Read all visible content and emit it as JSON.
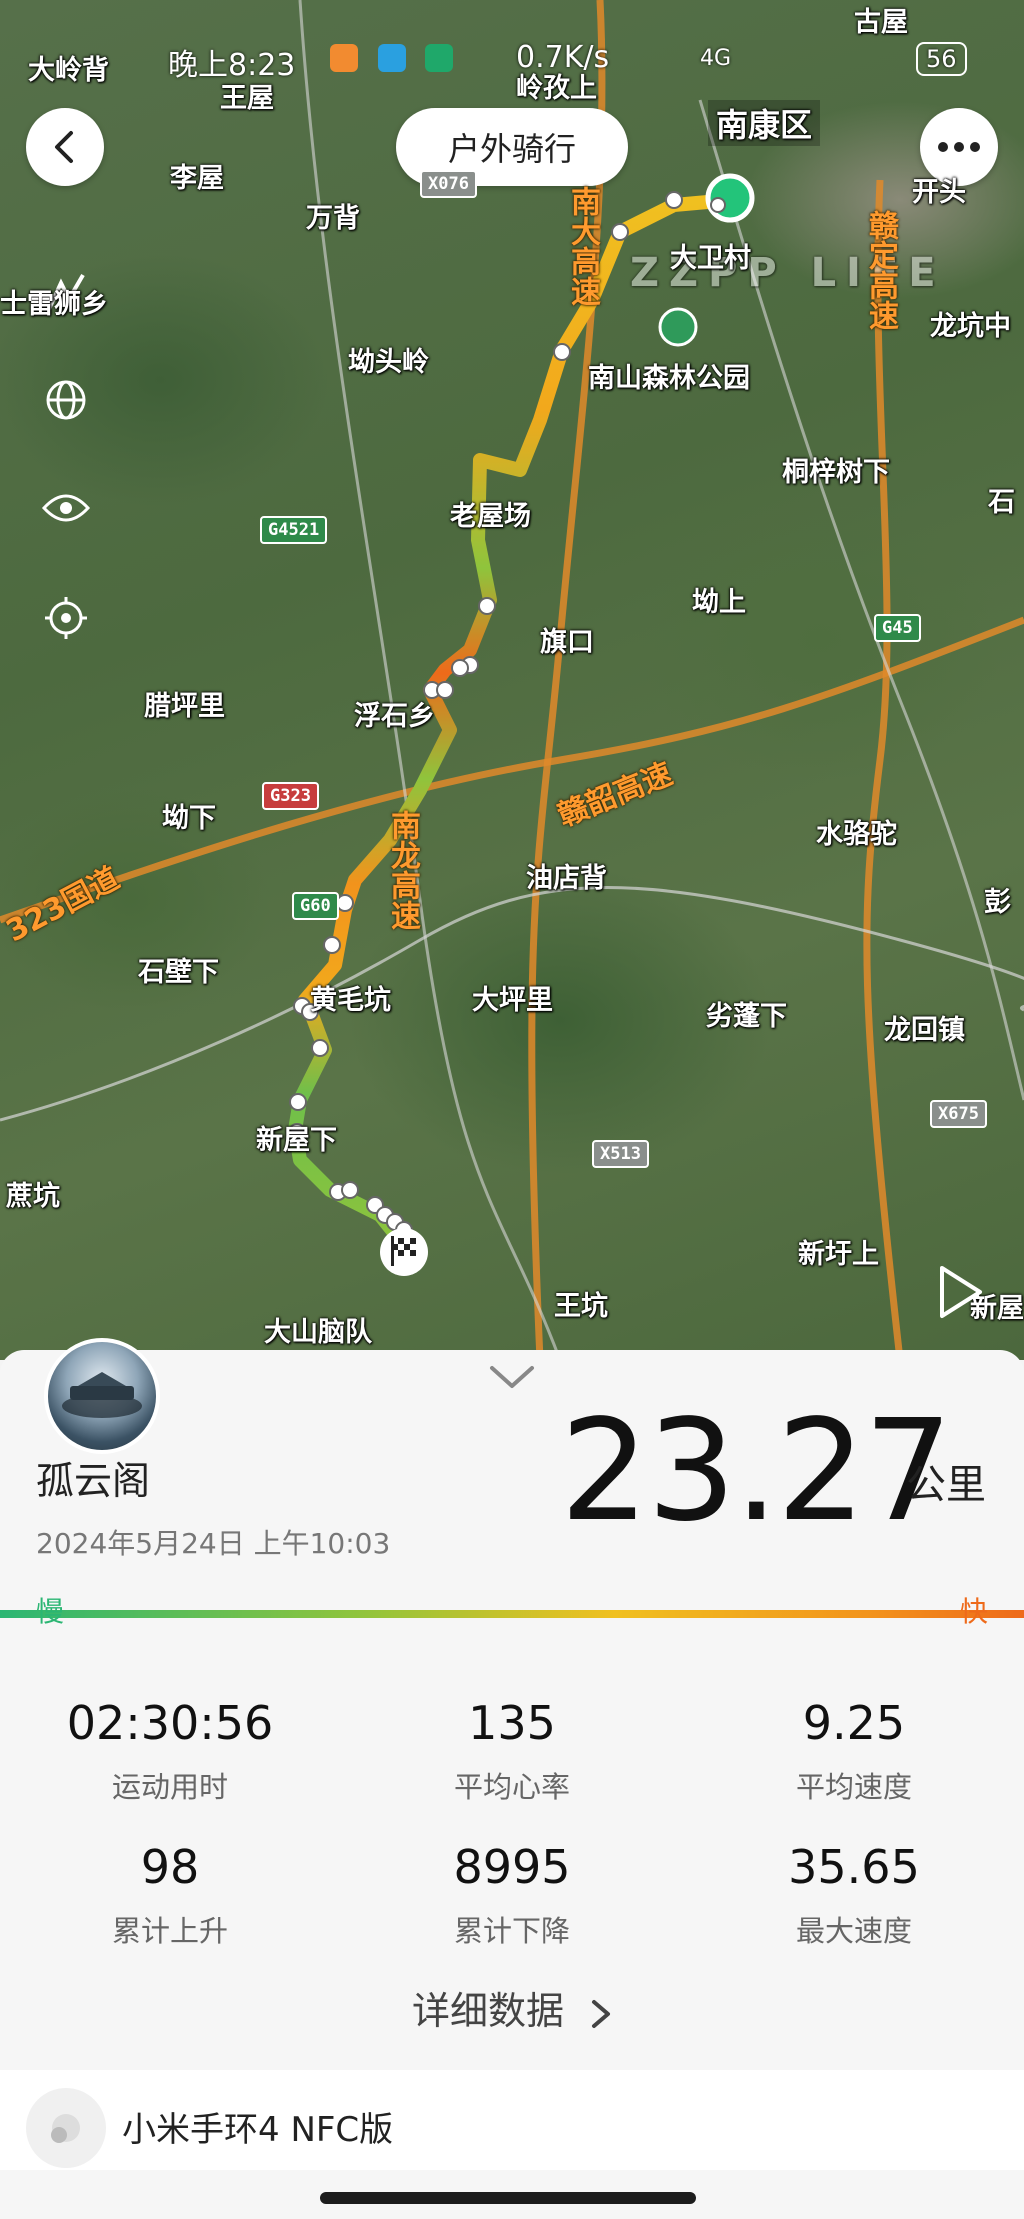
{
  "status_bar": {
    "time": "晚上8:23",
    "network_speed": "0.7K/s",
    "signal": "4G",
    "battery": "56"
  },
  "header": {
    "back_icon": "chevron-left-icon",
    "title": "户外骑行",
    "more_icon": "more-dots-icon"
  },
  "map": {
    "watermark": "ZZPP LIFE",
    "places": [
      "大岭背",
      "古屋",
      "岭孜上",
      "南康区",
      "王屋",
      "李屋",
      "万背",
      "大卫村",
      "开头",
      "士雷狮乡",
      "坳头岭",
      "南山森林公园",
      "龙坑中",
      "桐梓树下",
      "石",
      "老屋场",
      "坳上",
      "旗口",
      "腊坪里",
      "浮石乡",
      "坳下",
      "水骆驼",
      "油店背",
      "石壁下",
      "黄毛坑",
      "大坪里",
      "劣蓬下",
      "龙回镇",
      "彭",
      "新屋下",
      "蔗坑",
      "新圩上",
      "新屋",
      "王坑",
      "大山脑队"
    ],
    "roads": [
      "赣韶高速",
      "南大高速",
      "赣定高速",
      "南龙高速",
      "323国道"
    ],
    "shields": [
      "G4521",
      "G45",
      "G323",
      "G60",
      "X513",
      "X675",
      "X076"
    ]
  },
  "summary": {
    "username": "孤云阁",
    "datetime": "2024年5月24日 上午10:03",
    "distance": "23.27",
    "unit": "公里",
    "slow_label": "慢",
    "fast_label": "快"
  },
  "stats": [
    {
      "value": "02:30:56",
      "label": "运动用时"
    },
    {
      "value": "135",
      "label": "平均心率"
    },
    {
      "value": "9.25",
      "label": "平均速度"
    },
    {
      "value": "98",
      "label": "累计上升"
    },
    {
      "value": "8995",
      "label": "累计下降"
    },
    {
      "value": "35.65",
      "label": "最大速度"
    }
  ],
  "detail_link": "详细数据",
  "device": {
    "name": "小米手环4 NFC版"
  },
  "colors": {
    "slow": "#2bb673",
    "fast": "#ee6a1a",
    "mid": "#f0c020"
  }
}
